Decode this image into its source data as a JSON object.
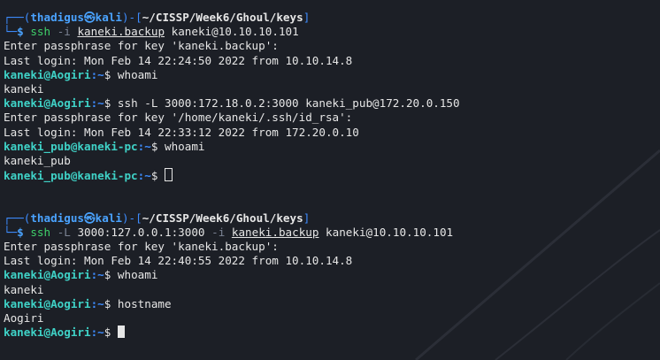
{
  "session1": {
    "corner1": "┌──(",
    "user": "thadigus",
    "at": "㉿",
    "host": "kali",
    "bracket_open": ")-[",
    "cwd": "~/CISSP/Week6/Ghoul/keys",
    "bracket_close": "]",
    "corner2": "└─",
    "dollar": "$ ",
    "cmd_ssh": "ssh",
    "opt_i": "-i",
    "keyfile": "kaneki.backup",
    "target": "kaneki@10.10.10.101",
    "out1": "Enter passphrase for key 'kaneki.backup':",
    "out2": "Last login: Mon Feb 14 22:24:50 2022 from 10.10.14.8",
    "p1_user": "kaneki@Aogiri",
    "p1_path": ":~",
    "p1_cmd": "$ whoami",
    "out3": "kaneki",
    "p2_user": "kaneki@Aogiri",
    "p2_path": ":~",
    "p2_cmd": "$ ssh -L 3000:172.18.0.2:3000 kaneki_pub@172.20.0.150",
    "out4": "Enter passphrase for key '/home/kaneki/.ssh/id_rsa':",
    "out5": "Last login: Mon Feb 14 22:33:12 2022 from 172.20.0.10",
    "p3_user": "kaneki_pub@kaneki-pc",
    "p3_path": ":~",
    "p3_cmd": "$ whoami",
    "out6": "kaneki_pub",
    "p4_user": "kaneki_pub@kaneki-pc",
    "p4_path": ":~",
    "p4_cmd": "$ "
  },
  "session2": {
    "corner1": "┌──(",
    "user": "thadigus",
    "at": "㉿",
    "host": "kali",
    "bracket_open": ")-[",
    "cwd": "~/CISSP/Week6/Ghoul/keys",
    "bracket_close": "]",
    "corner2": "└─",
    "dollar": "$ ",
    "cmd_ssh": "ssh",
    "opt_L": "-L",
    "fwd": "3000:127.0.0.1:3000",
    "opt_i": "-i",
    "keyfile": "kaneki.backup",
    "target": "kaneki@10.10.10.101",
    "out1": "Enter passphrase for key 'kaneki.backup':",
    "out2": "Last login: Mon Feb 14 22:40:55 2022 from 10.10.14.8",
    "p1_user": "kaneki@Aogiri",
    "p1_path": ":~",
    "p1_cmd": "$ whoami",
    "out3": "kaneki",
    "p2_user": "kaneki@Aogiri",
    "p2_path": ":~",
    "p2_cmd": "$ hostname",
    "out4": "Aogiri",
    "p3_user": "kaneki@Aogiri",
    "p3_path": ":~",
    "p3_cmd": "$ "
  },
  "colors": {
    "background": "#1c1f26",
    "prompt_blue": "#3d8cff",
    "prompt_user": "#3fd2c7",
    "command_green": "#3fd06a"
  }
}
